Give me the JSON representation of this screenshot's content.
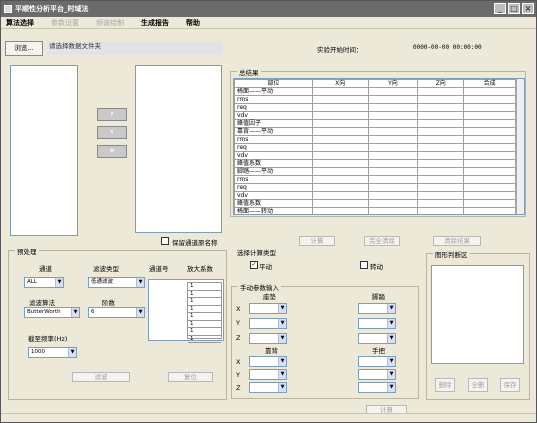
{
  "window": {
    "title": "平顺性分析平台_时域法"
  },
  "menu": [
    "算法选择",
    "参数设置",
    "频谱绘制",
    "生成报告",
    "帮助"
  ],
  "file": {
    "browse_label": "浏览...",
    "placeholder": "请选择数据文件夹"
  },
  "experiment": {
    "start_time_label": "实验开始时间：",
    "start_time_value": "0000-00-00 00:00:00"
  },
  "transfer": {
    "add": "›",
    "remove": "‹",
    "remove_all": "«"
  },
  "keep_name_label": "保留通道原名称",
  "results": {
    "title": "总结果",
    "columns": [
      "部位",
      "X向",
      "Y向",
      "Z向",
      "合成"
    ],
    "rows": [
      "椅面——平动",
      "rms",
      "req",
      "vdv",
      "峰值因子",
      "靠背——平动",
      "rms",
      "req",
      "vdv",
      "峰值系数",
      "脚踏——平动",
      "rms",
      "req",
      "vdv",
      "峰值系数",
      "椅面——转动"
    ]
  },
  "result_buttons": {
    "compute": "计算",
    "clear": "完全清除",
    "clear_result": "清除结果"
  },
  "preprocess": {
    "title": "预处理",
    "channel_label": "通道",
    "channel_value": "ALL",
    "filter_type_label": "滤波类型",
    "filter_type_value": "低通滤波",
    "channel_no_label": "通道号",
    "gain_label": "放大系数",
    "filter_algo_label": "滤波算法",
    "filter_algo_value": "ButterWorth",
    "order_label": "阶数",
    "order_value": "6",
    "cutoff_label": "截至频率(Hz)",
    "cutoff_value": "1000",
    "gains": [
      "1",
      "1",
      "1",
      "1",
      "1",
      "1",
      "1",
      "1"
    ],
    "filter_button": "滤波",
    "restore_button": "复位"
  },
  "calc_type": {
    "title": "选择计算类型",
    "translate": "平动",
    "rotate": "转动",
    "translate_checked": true,
    "rotate_checked": false
  },
  "manual": {
    "title": "手动参数输入",
    "seat": "座垫",
    "foot": "脚踏",
    "back": "靠背",
    "hand": "手把",
    "axes": [
      "X",
      "Y",
      "Z"
    ],
    "compute_button": "计算"
  },
  "graph": {
    "title": "图形判断区",
    "delete": "删除",
    "delete_all": "全删",
    "save": "保存"
  }
}
